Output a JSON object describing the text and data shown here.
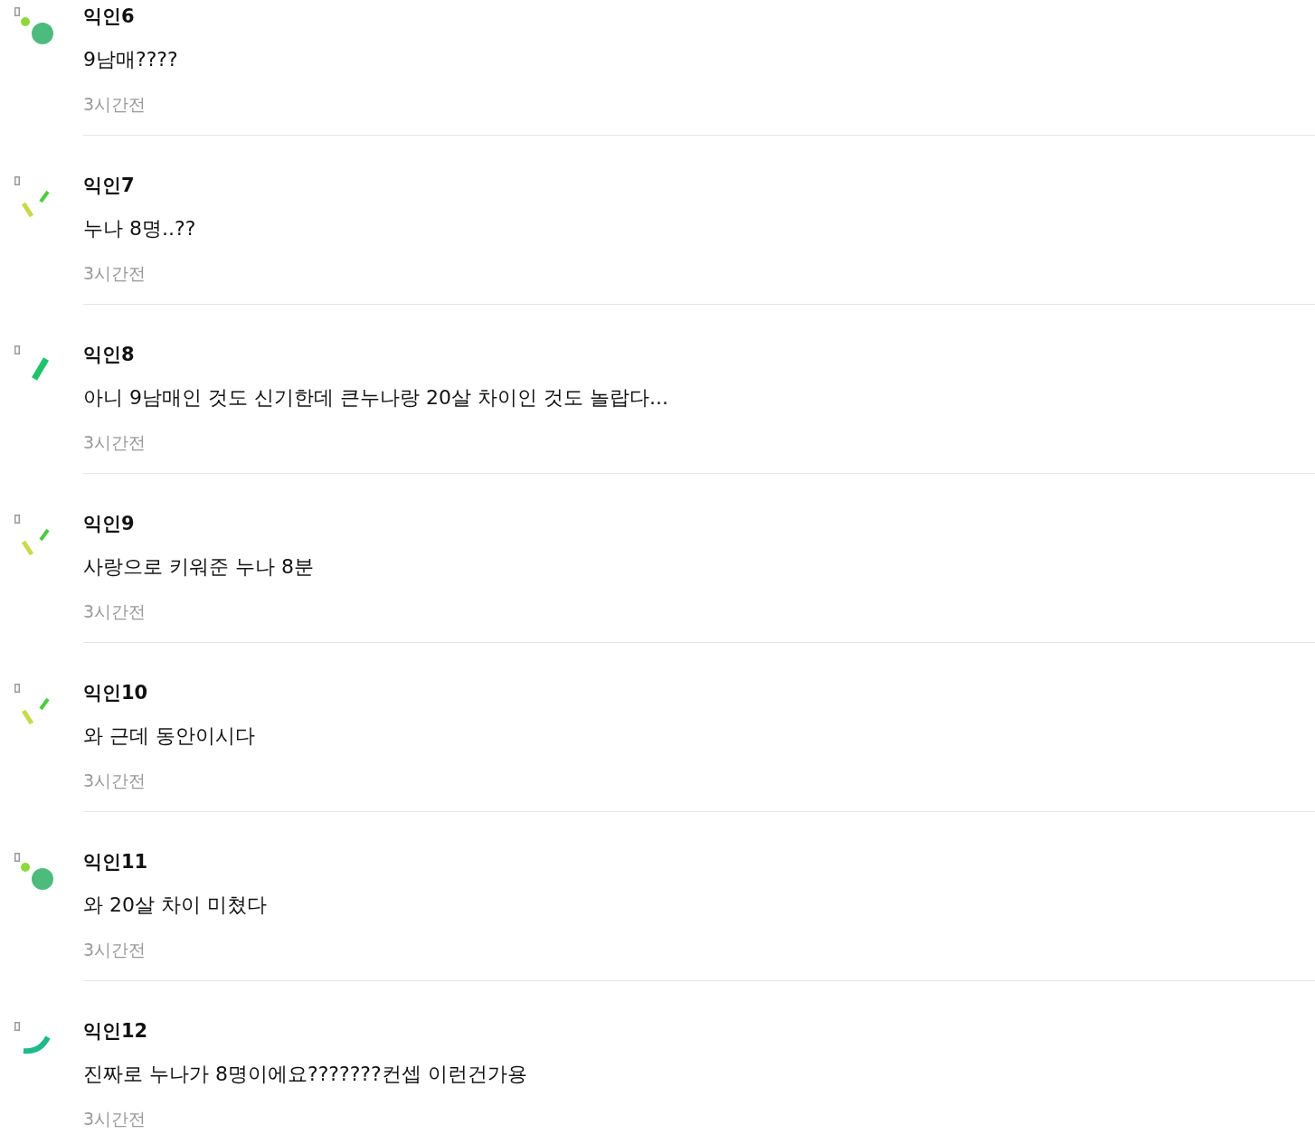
{
  "comments": [
    {
      "author": "익인6",
      "text": "9남매????",
      "time": "3시간전",
      "kind": "dots"
    },
    {
      "author": "익인7",
      "text": "누나 8명..??",
      "time": "3시간전",
      "kind": "dashes"
    },
    {
      "author": "익인8",
      "text": "아니 9남매인 것도 신기한데 큰누나랑 20살 차이인 것도 놀랍다...",
      "time": "3시간전",
      "kind": "bar"
    },
    {
      "author": "익인9",
      "text": "사랑으로 키워준 누나 8분",
      "time": "3시간전",
      "kind": "dashes"
    },
    {
      "author": "익인10",
      "text": "와 근데 동안이시다",
      "time": "3시간전",
      "kind": "dashes"
    },
    {
      "author": "익인11",
      "text": "와 20살 차이 미쳤다",
      "time": "3시간전",
      "kind": "dots"
    },
    {
      "author": "익인12",
      "text": "진짜로 누나가 8명이에요???????컨셉 이런건가용",
      "time": "3시간전",
      "kind": "arc"
    }
  ]
}
